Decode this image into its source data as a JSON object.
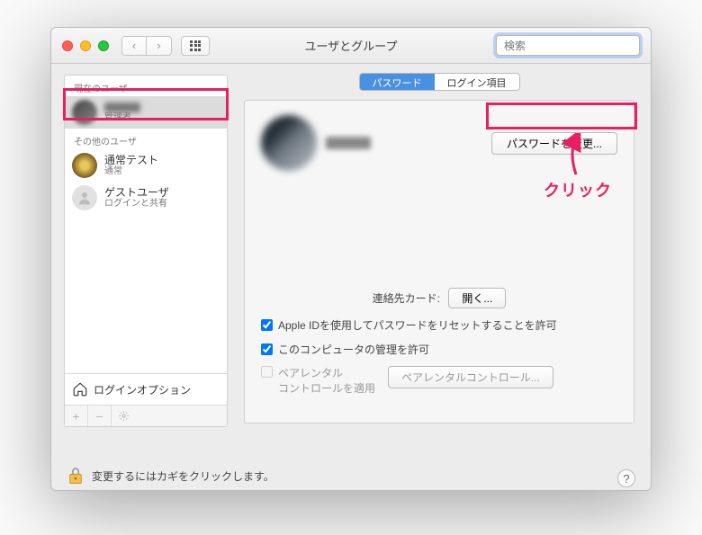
{
  "window": {
    "title": "ユーザとグループ"
  },
  "search": {
    "placeholder": "検索"
  },
  "sidebar": {
    "current_label": "現在のユーザ",
    "others_label": "その他のユーザ",
    "items": [
      {
        "name_hidden": true,
        "role": "管理者"
      },
      {
        "name": "通常テスト",
        "role": "通常"
      },
      {
        "name": "ゲストユーザ",
        "role": "ログインと共有"
      }
    ],
    "login_options": "ログインオプション",
    "footer": {
      "plus": "+",
      "minus": "−",
      "gear": "✻"
    }
  },
  "tabs": {
    "password": "パスワード",
    "login_items": "ログイン項目"
  },
  "main": {
    "fullname_hidden": true,
    "change_password_btn": "パスワードを変更...",
    "contact_label": "連絡先カード:",
    "open_btn": "開く...",
    "opt_reset_with_appleid": "Apple IDを使用してパスワードをリセットすることを許可",
    "opt_admin": "このコンピュータの管理を許可",
    "parental_line1": "ペアレンタル",
    "parental_line2": "コントロールを適用",
    "parental_btn": "ペアレンタルコントロール...",
    "checkboxes": {
      "appleid_reset": true,
      "admin": true,
      "parental": false
    }
  },
  "lockbar": {
    "text": "変更するにはカギをクリックします。"
  },
  "annotation": {
    "click": "クリック"
  }
}
